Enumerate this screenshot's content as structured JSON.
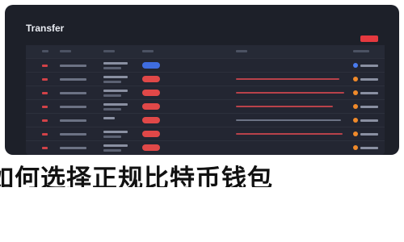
{
  "window": {
    "title": "Transfer"
  },
  "headline": {
    "text": "如何选择正规比特币钱包"
  },
  "colors": {
    "window_bg": "#1d2029",
    "accent_red": "#e04848",
    "accent_blue": "#3f6de0",
    "accent_orange": "#f08a2a"
  },
  "table": {
    "column_count": 7,
    "row_count": 8,
    "status_colors": [
      "blue",
      "red",
      "red",
      "red",
      "red",
      "red",
      "red",
      "red"
    ],
    "dot_colors": [
      "blue",
      "orange",
      "orange",
      "orange",
      "orange",
      "orange",
      "orange",
      "orange"
    ]
  }
}
